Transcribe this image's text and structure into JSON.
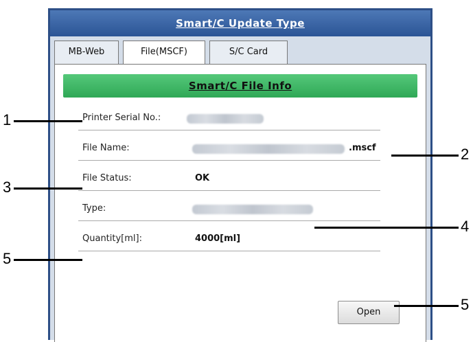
{
  "window": {
    "title": "Smart/C Update Type"
  },
  "tabs": [
    {
      "label": "MB-Web"
    },
    {
      "label": "File(MSCF)"
    },
    {
      "label": "S/C Card"
    }
  ],
  "panel": {
    "banner": "Smart/C File Info",
    "fields": [
      {
        "label": "Printer Serial No.:",
        "value": ""
      },
      {
        "label": "File Name:",
        "value": ".mscf"
      },
      {
        "label": "File Status:",
        "value": "OK"
      },
      {
        "label": "Type:",
        "value": ""
      },
      {
        "label": "Quantity[ml]:",
        "value": "4000[ml]"
      }
    ],
    "open_button": "Open"
  },
  "callouts": [
    "1",
    "2",
    "3",
    "4",
    "5",
    "5"
  ]
}
